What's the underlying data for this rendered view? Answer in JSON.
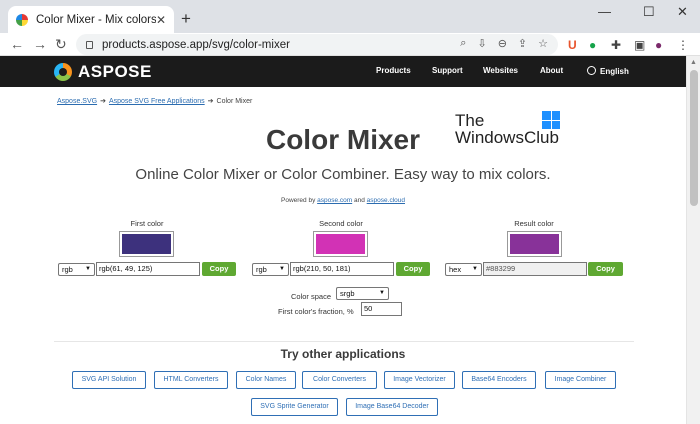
{
  "browser": {
    "tab_title": "Color Mixer - Mix colors online f",
    "tab_close": "✕",
    "new_tab": "+",
    "url": "products.aspose.app/svg/color-mixer",
    "window_minimize": "—",
    "window_maximize": "☐",
    "window_close": "✕"
  },
  "site": {
    "logo_text": "ASPOSE",
    "nav": [
      "Products",
      "Support",
      "Websites",
      "About"
    ],
    "language": "English"
  },
  "breadcrumb": {
    "items": [
      "Aspose.SVG",
      "Aspose SVG Free Applications",
      "Color Mixer"
    ],
    "separator": "➔"
  },
  "page": {
    "title": "Color Mixer",
    "subtitle": "Online Color Mixer or Color Combiner. Easy way to mix colors.",
    "powered_prefix": "Powered by",
    "powered_link1": "aspose.com",
    "powered_and": "and",
    "powered_link2": "aspose.cloud"
  },
  "watermark": {
    "line1": "The",
    "line2": "WindowsClub"
  },
  "mixer": {
    "first": {
      "label": "First color",
      "format": "rgb",
      "value": "rgb(61, 49, 125)",
      "color": "#3d317d",
      "copy": "Copy"
    },
    "second": {
      "label": "Second color",
      "format": "rgb",
      "value": "rgb(210, 50, 181)",
      "color": "#d232b5",
      "copy": "Copy"
    },
    "result": {
      "label": "Result color",
      "format": "hex",
      "value": "#883299",
      "color": "#883299",
      "copy": "Copy"
    },
    "color_space_label": "Color space",
    "color_space_value": "srgb",
    "fraction_label": "First color's fraction, %",
    "fraction_value": "50"
  },
  "other_apps": {
    "title": "Try other applications",
    "row1": [
      "SVG API Solution",
      "HTML Converters",
      "Color Names",
      "Color Converters",
      "Image Vectorizer",
      "Base64 Encoders",
      "Image Combiner"
    ],
    "row2": [
      "SVG Sprite Generator",
      "Image Base64 Decoder"
    ]
  },
  "colors": {
    "accent_green": "#5fa832",
    "link_blue": "#2f6fb5",
    "header_bg": "#1b1b1b"
  }
}
